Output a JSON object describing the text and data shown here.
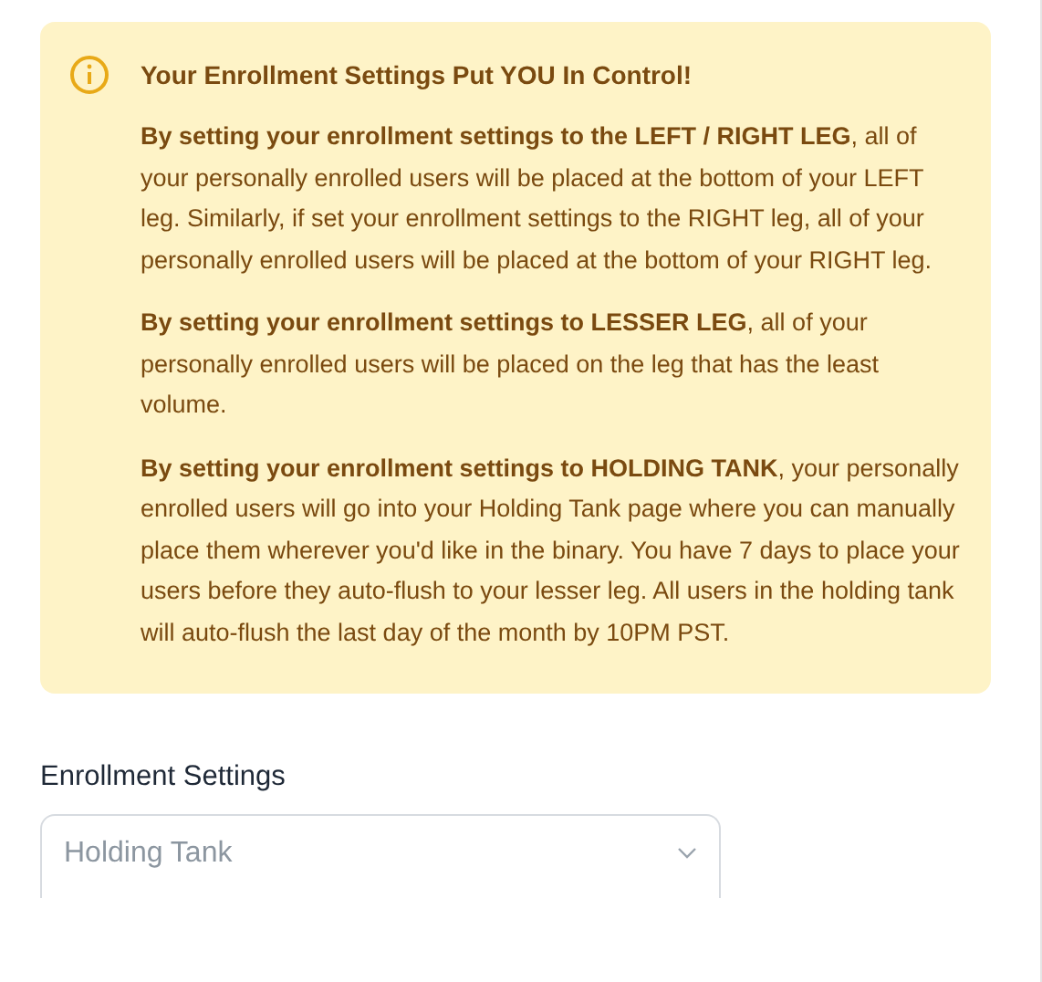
{
  "alert": {
    "title": "Your Enrollment Settings Put YOU In Control!",
    "paragraphs": [
      "**By setting your enrollment settings to the LEFT / RIGHT LEG**, all of your personally enrolled users will be placed at the bottom of your LEFT leg. Similarly, if set your enrollment settings to the RIGHT leg, all of your personally enrolled users will be placed at the bottom of your RIGHT leg.",
      "**By setting your enrollment settings to LESSER LEG**, all of your personally enrolled users will be placed on the leg that has the least volume.",
      "**By setting your enrollment settings to HOLDING TANK**, your personally enrolled users will go into your Holding Tank page where you can manually place them wherever you'd like in the binary. You have 7 days to place your users before they auto-flush to your lesser leg. All users in the holding tank will auto-flush the last day of the month by 10PM PST."
    ]
  },
  "field": {
    "label": "Enrollment Settings",
    "value": "Holding Tank"
  }
}
